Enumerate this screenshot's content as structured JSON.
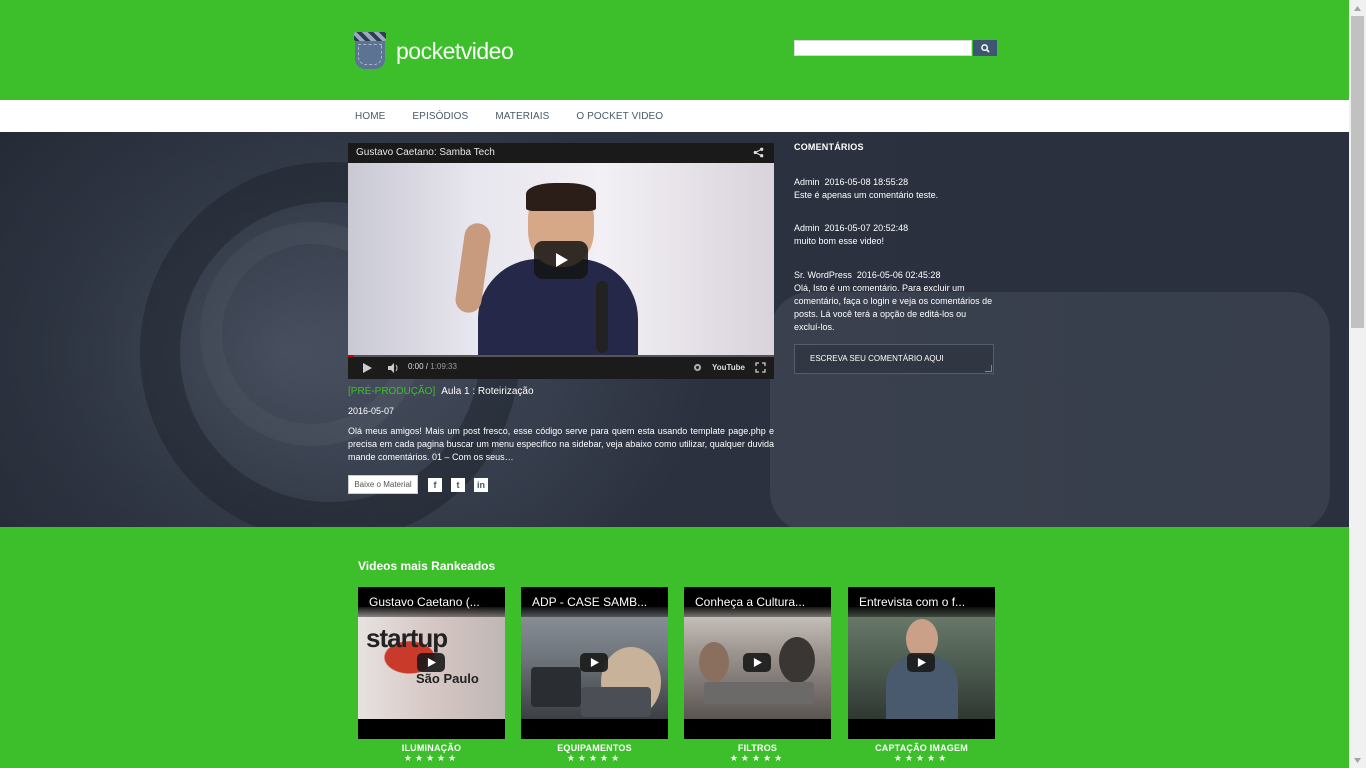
{
  "brand": {
    "logo_part1": "pocket",
    "logo_part2": "video"
  },
  "search": {
    "value": "",
    "placeholder": ""
  },
  "nav": {
    "items": [
      "HOME",
      "EPISÓDIOS",
      "MATERIAIS",
      "O POCKET VIDEO"
    ]
  },
  "player": {
    "title": "Gustavo Caetano: Samba Tech",
    "current_time": "0:00",
    "duration": "1:09:33",
    "progress": 0,
    "brand_label": "YouTube"
  },
  "post": {
    "category": "[PRÉ-PRODUÇÃO]",
    "title": "Aula 1 : Roteirização",
    "date": "2016-05-07",
    "excerpt": "Olá meus amigos! Mais um post fresco, esse código serve para quem esta usando template page.php e precisa em cada pagina buscar um menu especifico na sidebar, veja abaixo como utilizar, qualquer duvida mande comentários. 01 – Com os seus…",
    "download_label": "Baixe o Material",
    "social": [
      {
        "icon": "facebook-icon",
        "glyph": "f"
      },
      {
        "icon": "twitter-icon",
        "glyph": "t"
      },
      {
        "icon": "linkedin-icon",
        "glyph": "in"
      }
    ]
  },
  "comments": {
    "heading": "COMENTÁRIOS",
    "items": [
      {
        "author": "Admin",
        "date": "2016-05-08 18:55:28",
        "text": "Este é apenas um comentário teste."
      },
      {
        "author": "Admin",
        "date": "2016-05-07 20:52:48",
        "text": "muito bom esse video!"
      },
      {
        "author": "Sr. WordPress",
        "date": "2016-05-06 02:45:28",
        "text": "Olá, Isto é um comentário. Para excluir um comentário, faça o login e veja os comentários de posts. Lá você terá a opção de editá-los ou excluí-los."
      }
    ],
    "input_placeholder": "ESCREVA SEU COMENTÁRIO AQUI"
  },
  "ranked": {
    "heading": "Videos mais Rankeados",
    "cards": [
      {
        "title": "Gustavo Caetano (...",
        "category": "ILUMINAÇÃO",
        "stars": "★★★★★",
        "thumb_text1": "startup",
        "thumb_text2": "São Paulo"
      },
      {
        "title": "ADP - CASE SAMB...",
        "category": "EQUIPAMENTOS",
        "stars": "★★★★★"
      },
      {
        "title": "Conheça a Cultura...",
        "category": "FILTROS",
        "stars": "★★★★★"
      },
      {
        "title": "Entrevista com o f...",
        "category": "CAPTAÇÃO IMAGEM",
        "stars": "★★★★★"
      }
    ]
  },
  "colors": {
    "brand_green": "#3dbf2b",
    "nav_bg": "#ffffff",
    "hero_dark": "#3e4656",
    "button_blue": "#3f5672"
  }
}
